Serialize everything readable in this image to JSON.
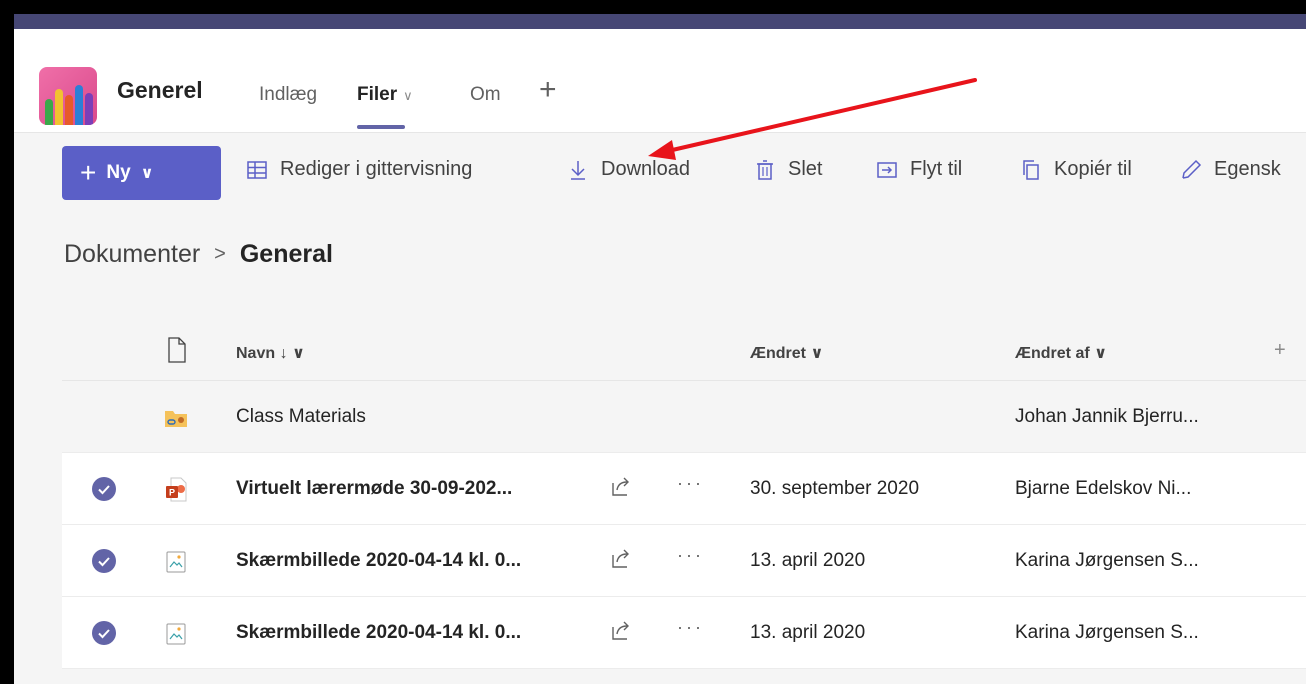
{
  "header": {
    "channel_title": "Generel",
    "tabs": [
      {
        "label": "Indlæg"
      },
      {
        "label": "Filer"
      },
      {
        "label": "Om"
      }
    ],
    "filer_chevron": "∨",
    "add_tab": "+"
  },
  "toolbar": {
    "new_label": "Ny",
    "new_plus": "+",
    "new_chevron": "∨",
    "items": [
      {
        "label": "Rediger i gittervisning",
        "icon": "grid-icon"
      },
      {
        "label": "Download",
        "icon": "download-icon"
      },
      {
        "label": "Slet",
        "icon": "trash-icon"
      },
      {
        "label": "Flyt til",
        "icon": "move-icon"
      },
      {
        "label": "Kopiér til",
        "icon": "copy-icon"
      },
      {
        "label": "Egensk",
        "icon": "pencil-icon"
      }
    ]
  },
  "breadcrumb": {
    "root": "Dokumenter",
    "separator": ">",
    "current": "General"
  },
  "columns": {
    "name": "Navn ↓ ∨",
    "modified": "Ændret ∨",
    "modified_by": "Ændret af ∨",
    "add": "+"
  },
  "rows": [
    {
      "name": "Class Materials",
      "modified": "",
      "modified_by": "Johan Jannik Bjerru...",
      "type": "folder",
      "selected": false
    },
    {
      "name": "Virtuelt lærermøde 30-09-202...",
      "modified": "30. september 2020",
      "modified_by": "Bjarne Edelskov Ni...",
      "type": "pptx",
      "selected": true
    },
    {
      "name": "Skærmbillede 2020-04-14 kl. 0...",
      "modified": "13. april 2020",
      "modified_by": "Karina Jørgensen S...",
      "type": "image",
      "selected": true
    },
    {
      "name": "Skærmbillede 2020-04-14 kl. 0...",
      "modified": "13. april 2020",
      "modified_by": "Karina Jørgensen S...",
      "type": "image",
      "selected": true
    }
  ],
  "row_menu": "···",
  "colors": {
    "accent": "#6264a7",
    "new_button": "#5b5fc7",
    "annotation_arrow": "#e8141b"
  }
}
